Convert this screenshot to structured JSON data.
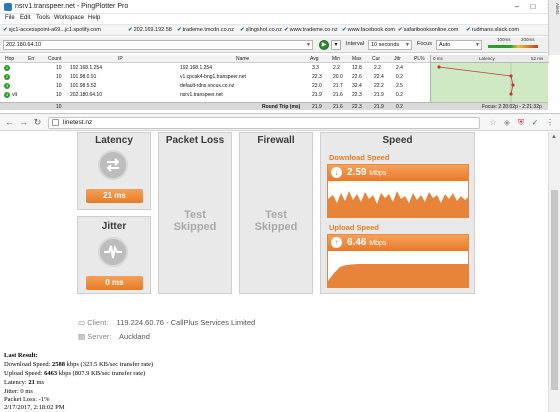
{
  "window": {
    "title": "nsrv1.transpeer.net - PingPlotter Pro",
    "minimize": "–",
    "maximize": "□",
    "close": "✕"
  },
  "menu": [
    "File",
    "Edit",
    "Tools",
    "Workspace",
    "Help"
  ],
  "bookmarks": [
    "sjc1-accesspoint-a69...jc1.spotify.com",
    "202.169.192.58",
    "trademe.tmcdn.co.nz",
    "slingshot.co.nz",
    "www.trademe.co.nz",
    "www.facebook.com",
    "safaribooksonline.com",
    "rudmans.slack.com"
  ],
  "toolbar": {
    "target": "202.180.64.10",
    "interval_label": "Interval",
    "interval_value": "10 seconds",
    "focus_label": "Focus",
    "focus_value": "Auto",
    "legend_100": "100ms",
    "legend_200": "200ms",
    "alerts_label": "Alerts"
  },
  "pingplotter": {
    "columns": [
      "Hop",
      "Err",
      "Count",
      "IP",
      "Name",
      "Avg",
      "Min",
      "Max",
      "Cur",
      "Jttr",
      "PL%"
    ],
    "graph_header": {
      "left": "0 ms",
      "center": "Latency",
      "right": "52 ms"
    },
    "rows": [
      {
        "hop": "1",
        "count": "10",
        "ip": "192.168.1.254",
        "name": "192.168.1.254",
        "avg": "3.3",
        "min": "2.2",
        "max": "12.8",
        "cur": "2.2",
        "jttr": "2.4"
      },
      {
        "hop": "2",
        "count": "10",
        "ip": "101.98.0.91",
        "name": "v1.cpcak4-bng1.transpeer.net",
        "avg": "22.3",
        "min": "20.0",
        "max": "22.6",
        "cur": "22.4",
        "jttr": "0.2"
      },
      {
        "hop": "3",
        "count": "10",
        "ip": "101.98.5.52",
        "name": "default-rdns.vocus.co.nz",
        "avg": "23.0",
        "min": "21.7",
        "max": "32.4",
        "cur": "22.2",
        "jttr": "2.5"
      },
      {
        "hop": "4",
        "hop_extra": "vlt",
        "count": "10",
        "ip": "202.180.64.10",
        "name": "nsrv1.transpeer.net",
        "avg": "21.9",
        "min": "21.6",
        "max": "22.3",
        "cur": "21.9",
        "jttr": "0.2"
      }
    ],
    "footer": {
      "count": "10",
      "label": "Round Trip (ms)",
      "avg": "21.9",
      "min": "21.6",
      "max": "22.3",
      "cur": "21.9",
      "jttr": "0.2",
      "focus": "Focus: 2:20:02p - 2:21:32p"
    }
  },
  "browser": {
    "url": "linetest.nz",
    "back": "←",
    "forward": "→",
    "reload": "↻"
  },
  "linetest": {
    "latency": {
      "title": "Latency",
      "value": "21 ms"
    },
    "jitter": {
      "title": "Jitter",
      "value": "0 ms"
    },
    "packet_loss": {
      "title": "Packet Loss",
      "line1": "Test",
      "line2": "Skipped"
    },
    "firewall": {
      "title": "Firewall",
      "line1": "Test",
      "line2": "Skipped"
    },
    "speed": {
      "title": "Speed",
      "download_label": "Download Speed",
      "download_value": "2.59",
      "upload_label": "Upload Speed",
      "upload_value": "6.46",
      "unit": "Mbps"
    },
    "client_label": "Client:",
    "client_value": "119.224.60.76 - CallPlus Services Limited",
    "server_label": "Server:",
    "server_value": "Auckland"
  },
  "last_result": {
    "heading": "Last Result:",
    "download_prefix": "Download Speed:",
    "download_value": "2588",
    "download_suffix": "kbps (323.5 KB/sec transfer rate)",
    "upload_prefix": "Upload Speed:",
    "upload_value": "6463",
    "upload_suffix": "kbps (807.9 KB/sec transfer rate)",
    "latency_prefix": "Latency:",
    "latency_value": "21",
    "latency_suffix": "ms",
    "jitter": "Jitter: 0 ms",
    "packet_loss": "Packet Loss: -1%",
    "timestamp": "2/17/2017, 2:18:02 PM"
  }
}
